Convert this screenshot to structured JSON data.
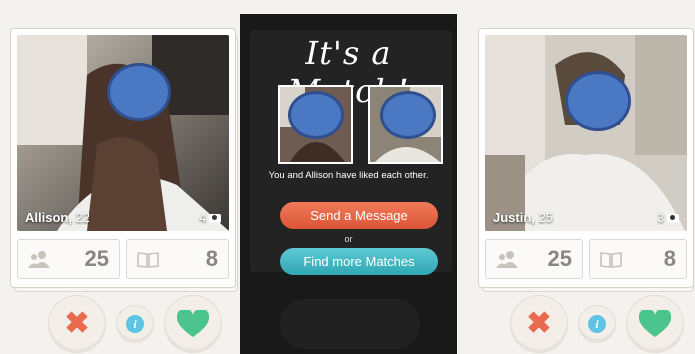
{
  "profiles": {
    "left": {
      "name": "Allison",
      "age": "22",
      "photo_count": "4",
      "friends_count": "25",
      "interests_count": "8"
    },
    "right": {
      "name": "Justin",
      "age": "25",
      "photo_count": "3",
      "friends_count": "25",
      "interests_count": "8"
    }
  },
  "match": {
    "title": "It's a Match!",
    "caption": "You and Allison have liked each other.",
    "send_message_label": "Send a Message",
    "or_label": "or",
    "find_more_label": "Find more Matches"
  },
  "icons": {
    "nope": "x-icon",
    "info": "info-icon",
    "like": "heart-icon",
    "friends": "people-icon",
    "interests": "book-icon",
    "photos": "camera-icon"
  },
  "colors": {
    "nope": "#e96a4f",
    "like": "#4cc48d",
    "info": "#5ec4e4",
    "send_message": "#e4603f",
    "find_more": "#3bb2bd",
    "face_blur": "#4b78c2"
  }
}
